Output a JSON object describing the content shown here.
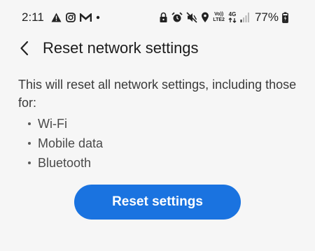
{
  "status_bar": {
    "time": "2:11",
    "left_icons": [
      "warning-icon",
      "instagram-icon",
      "gmail-icon",
      "dot-icon"
    ],
    "right_icons": [
      "lock-icon",
      "alarm-icon",
      "mute-icon",
      "location-icon",
      "volte-icon",
      "4g-icon",
      "signal-icon"
    ],
    "volte_line1": "Vo))",
    "volte_line2": "LTE2",
    "network_type": "4G",
    "battery_percent": "77%"
  },
  "header": {
    "title": "Reset network settings",
    "back_icon": "chevron-left-icon"
  },
  "content": {
    "description": "This will reset all network settings, including those for:",
    "items": [
      {
        "label": "Wi-Fi"
      },
      {
        "label": "Mobile data"
      },
      {
        "label": "Bluetooth"
      }
    ]
  },
  "actions": {
    "reset_label": "Reset settings"
  },
  "colors": {
    "background": "#f6f6f6",
    "accent": "#1a73e0",
    "text_primary": "#1c1c1c",
    "text_secondary": "#3a3a3a"
  }
}
